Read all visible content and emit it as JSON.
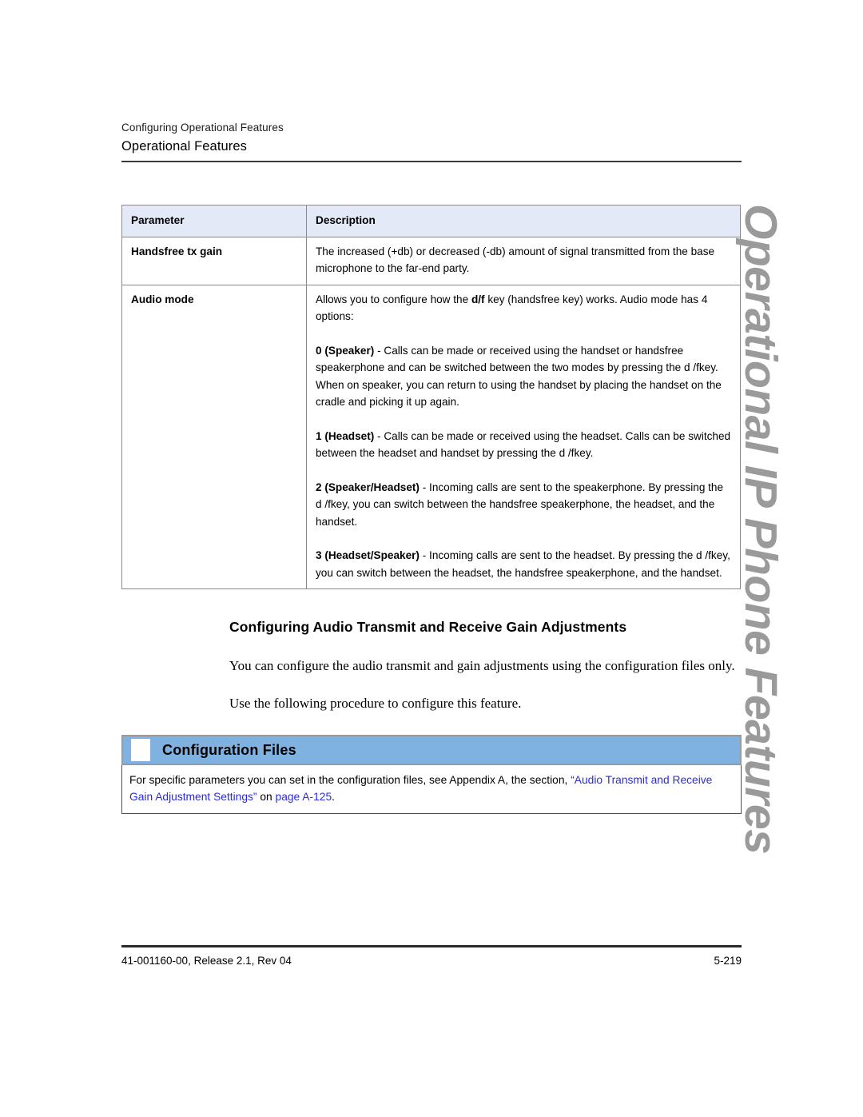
{
  "header": {
    "breadcrumb": "Configuring Operational Features",
    "chapter_title": "Operational Features"
  },
  "side_running_title": "Operational IP Phone Features",
  "table": {
    "columns": [
      "Parameter",
      "Description"
    ],
    "rows": [
      {
        "parameter": "Handsfree tx gain",
        "description_paragraphs": [
          "The increased (+db) or decreased (-db) amount of signal transmitted from the base microphone to the far-end party."
        ]
      },
      {
        "parameter": "Audio mode",
        "description_paragraphs": [
          "Allows you to configure how the d/f key (handsfree key) works. Audio mode has 4 options:",
          "0 (Speaker) - Calls can be made or received using the handset or handsfree speakerphone and can be switched between the two modes by pressing the d /fkey. When on speaker, you can return to using the handset by placing the handset on the cradle and picking it up again.",
          "1 (Headset) - Calls can be made or received using the headset. Calls can be switched between the headset and handset by pressing the d /fkey.",
          "2 (Speaker/Headset) - Incoming calls are sent to the speakerphone. By pressing the d /fkey, you can switch between the handsfree speakerphone, the headset, and the handset.",
          "3 (Headset/Speaker) - Incoming calls are sent to the headset. By pressing the d /fkey, you can switch between the headset, the handsfree speakerphone, and the handset."
        ]
      }
    ]
  },
  "section": {
    "heading": "Configuring Audio Transmit and Receive Gain Adjustments",
    "paragraph_1": "You can configure the audio transmit and gain adjustments using the configuration files only.",
    "paragraph_2": "Use the following procedure to configure this feature."
  },
  "callout": {
    "icon": "document-square-icon",
    "title": "Configuration Files",
    "body_plain_prefix": "For specific parameters you can set in the configuration files, see Appendix A, the section, ",
    "body_link_1": "“Audio Transmit and Receive Gain Adjustment Settings”",
    "body_plain_middle": " on ",
    "body_link_2": "page A-125",
    "body_plain_suffix": ".",
    "header_color": "#7fb2e0",
    "link_color": "#2b2bdd"
  },
  "footer": {
    "document_id": "41-001160-00, Release 2.1, Rev 04",
    "page_number": "5-219"
  }
}
